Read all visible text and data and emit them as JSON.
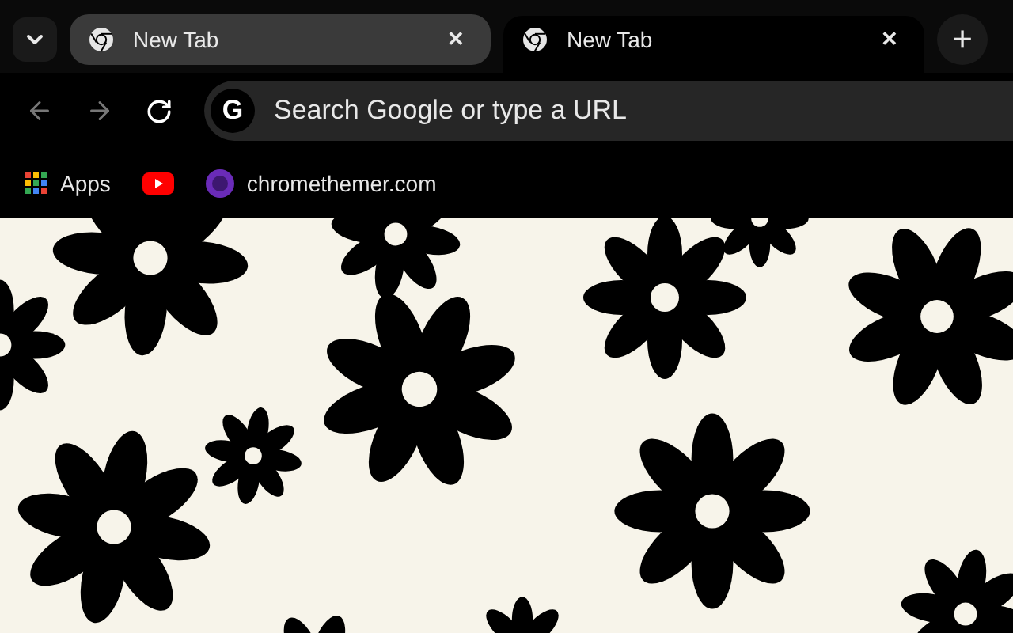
{
  "tabs": [
    {
      "label": "New Tab",
      "close": "✕",
      "selected": false
    },
    {
      "label": "New Tab",
      "close": "✕",
      "selected": true
    }
  ],
  "new_tab": "+",
  "omnibox": {
    "logo": "G",
    "placeholder": "Search Google or type a URL"
  },
  "bookmarks": [
    {
      "kind": "apps",
      "label": "Apps"
    },
    {
      "kind": "youtube"
    },
    {
      "kind": "site",
      "label": "chromethemer.com"
    }
  ]
}
